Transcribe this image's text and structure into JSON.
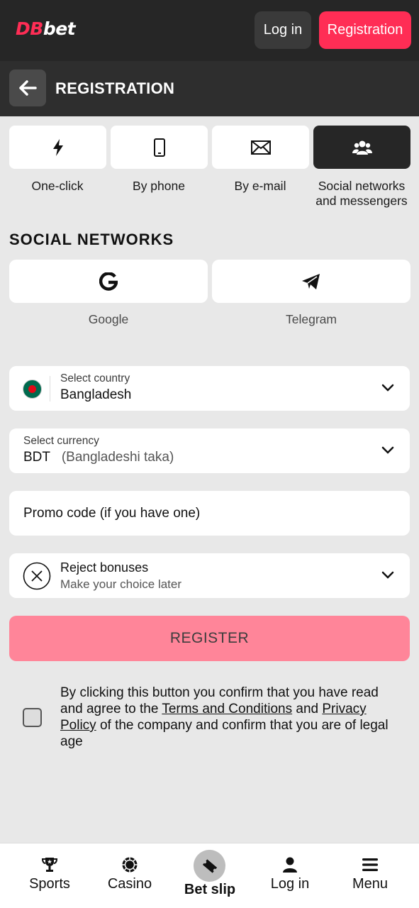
{
  "header": {
    "logo_prefix": "DB",
    "logo_suffix": "bet",
    "login_label": "Log in",
    "registration_label": "Registration"
  },
  "subheader": {
    "title": "REGISTRATION"
  },
  "methods": [
    {
      "label": "One-click",
      "icon": "lightning-icon"
    },
    {
      "label": "By phone",
      "icon": "phone-icon"
    },
    {
      "label": "By e-mail",
      "icon": "mail-icon"
    },
    {
      "label": "Social networks and messengers",
      "icon": "users-icon",
      "active": true
    }
  ],
  "social": {
    "title": "SOCIAL NETWORKS",
    "items": [
      {
        "label": "Google",
        "icon": "google-icon"
      },
      {
        "label": "Telegram",
        "icon": "telegram-icon"
      }
    ]
  },
  "country": {
    "label": "Select country",
    "value": "Bangladesh"
  },
  "currency": {
    "label": "Select currency",
    "code": "BDT",
    "name": "(Bangladeshi taka)"
  },
  "promo": {
    "placeholder": "Promo code (if you have one)"
  },
  "bonus": {
    "title": "Reject bonuses",
    "subtitle": "Make your choice later"
  },
  "register_label": "REGISTER",
  "consent": {
    "part1": "By clicking this button you confirm that you have read and agree to the ",
    "terms": "Terms and Conditions",
    "and": " and ",
    "privacy": "Privacy Policy",
    "part2": " of the company and confirm that you are of legal age"
  },
  "nav": [
    {
      "label": "Sports",
      "icon": "trophy-icon"
    },
    {
      "label": "Casino",
      "icon": "chip-icon"
    },
    {
      "label": "Bet slip",
      "icon": "ticket-icon"
    },
    {
      "label": "Log in",
      "icon": "user-icon"
    },
    {
      "label": "Menu",
      "icon": "menu-icon"
    }
  ],
  "colors": {
    "accent": "#ff2d55",
    "register_button": "#ff8599",
    "header_bg": "#262626"
  }
}
